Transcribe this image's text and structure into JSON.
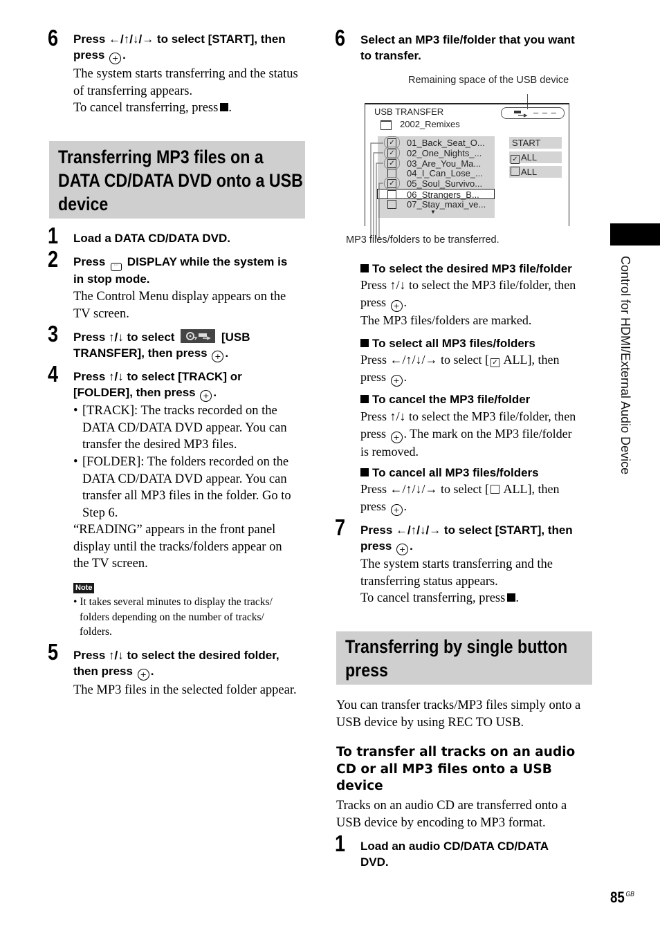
{
  "left_column": {
    "step6_top": {
      "number": "6",
      "heading_line1": "Press ←/↑/↓/→ to select [START], then",
      "heading_line2": "press",
      "body_line1": "The system starts transferring and the status",
      "body_line2": "of transferring appears.",
      "cancel_text": "To cancel transferring, press"
    },
    "banner": {
      "line1": "Transferring MP3 files on a",
      "line2": "DATA CD/DATA DVD onto a USB",
      "line3": "device"
    },
    "step1": {
      "number": "1",
      "heading": "Load a DATA CD/DATA DVD."
    },
    "step2": {
      "number": "2",
      "heading_pre": "Press",
      "heading_post": "DISPLAY while the system is",
      "heading_line2": "in stop mode.",
      "body_line1": "The Control Menu display appears on the",
      "body_line2": "TV screen."
    },
    "step3": {
      "number": "3",
      "heading_pre": "Press ↑/↓ to select",
      "heading_post": "[USB",
      "heading_line2": "TRANSFER], then press"
    },
    "step4": {
      "number": "4",
      "heading_line1": "Press ↑/↓ to select [TRACK] or",
      "heading_line2": "[FOLDER], then press",
      "bullets": [
        {
          "lines": [
            "[TRACK]: The tracks recorded on the",
            "DATA CD/DATA DVD appear. You can",
            "transfer the desired MP3 files."
          ]
        },
        {
          "lines": [
            "[FOLDER]: The folders recorded on the",
            "DATA CD/DATA DVD appear. You can",
            "transfer all MP3 files in the folder. Go to",
            "Step 6."
          ]
        }
      ],
      "reading_lines": [
        "“READING” appears in the front panel",
        "display until the tracks/folders appear on",
        "the TV screen."
      ]
    },
    "note": {
      "badge": "Note",
      "lines": [
        "It takes several minutes to display the tracks/",
        "folders depending on the number of tracks/",
        "folders."
      ]
    },
    "step5": {
      "number": "5",
      "heading_line1": "Press ↑/↓ to select the desired folder,",
      "heading_line2": "then press",
      "body": "The MP3 files in the selected folder appear."
    }
  },
  "right_column": {
    "step6": {
      "number": "6",
      "heading_line1": "Select an MP3 file/folder that you want",
      "heading_line2": "to transfer."
    },
    "screen": {
      "callout_top": "Remaining space of the USB device",
      "callout_bottom": "MP3 files/folders to be transferred.",
      "title": "USB TRANSFER",
      "usb_space": "– – –",
      "folder": "2002_Remixes",
      "files": [
        {
          "name": "01_Back_Seat_O...",
          "checked": true,
          "cursor": false
        },
        {
          "name": "02_One_Nights_...",
          "checked": true,
          "cursor": false
        },
        {
          "name": "03_Are_You_Ma...",
          "checked": true,
          "cursor": false
        },
        {
          "name": "04_I_Can_Lose_...",
          "checked": false,
          "cursor": false
        },
        {
          "name": "05_Soul_Survivo...",
          "checked": true,
          "cursor": false
        },
        {
          "name": "06_Strangers_B...",
          "checked": false,
          "cursor": true
        },
        {
          "name": "07_Stay_maxi_ve...",
          "checked": false,
          "cursor": false
        }
      ],
      "more_arrow": "▼",
      "buttons": {
        "start": "START",
        "select_all": "ALL",
        "cancel_all": "ALL"
      }
    },
    "sub1": {
      "title": "To select the desired MP3 file/folder",
      "line1": "Press ↑/↓ to select the MP3 file/folder, then",
      "line2": "press",
      "line3": "The MP3 files/folders are marked."
    },
    "sub2": {
      "title": "To select all MP3 files/folders",
      "line1_pre": "Press ←/↑/↓/→ to select [",
      "line1_post": "ALL], then",
      "line2": "press"
    },
    "sub3": {
      "title": "To cancel the MP3 file/folder",
      "line1": "Press ↑/↓ to select the MP3 file/folder, then",
      "line2_pre": "press",
      "line2_post": ". The mark on the MP3 file/folder",
      "line3": "is removed."
    },
    "sub4": {
      "title": "To cancel all MP3 files/folders",
      "line1_pre": "Press ←/↑/↓/→ to select [",
      "line1_post": "ALL], then",
      "line2": "press"
    },
    "step7": {
      "number": "7",
      "heading_line1": "Press ←/↑/↓/→ to select [START], then",
      "heading_line2": "press",
      "body_line1": "The system starts transferring and the",
      "body_line2": "transferring status appears.",
      "cancel_text": "To cancel transferring, press"
    },
    "banner2": {
      "line1": "Transferring by single button",
      "line2": "press"
    },
    "intro": [
      "You can transfer tracks/MP3 files simply onto a",
      "USB device by using REC TO USB."
    ],
    "heading2": [
      "To transfer all tracks on an audio",
      "CD or all MP3 files onto a USB",
      "device"
    ],
    "heading2_body": [
      "Tracks on an audio CD are transferred onto a",
      "USB device by encoding to MP3 format."
    ],
    "step1b": {
      "number": "1",
      "line1": "Load an audio CD/DATA CD/DATA",
      "line2": "DVD."
    }
  },
  "side_tab": {
    "label": "Control for HDMI/External Audio Device"
  },
  "footer": {
    "page_number": "85",
    "page_suffix": "GB"
  },
  "symbols": {
    "enter": "+",
    "check": "✓"
  }
}
